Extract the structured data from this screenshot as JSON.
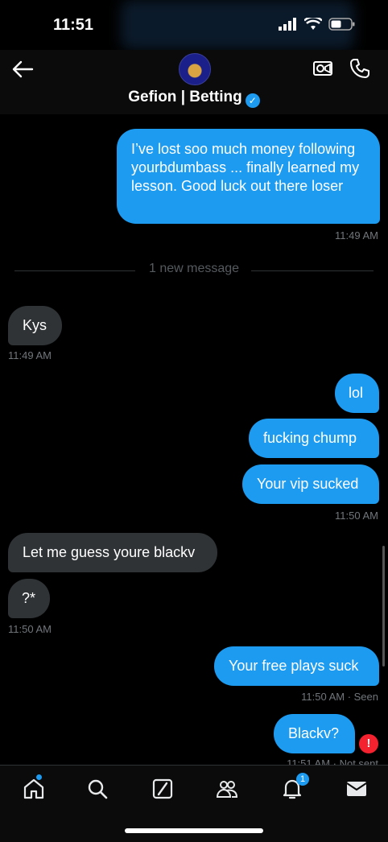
{
  "status_bar": {
    "time": "11:51"
  },
  "header": {
    "contact_name": "Gefion | Betting",
    "verified_mark": "✓"
  },
  "messages": [
    {
      "text": "I’ve lost soo much money following yourbdumbass ... finally learned my lesson.  Good luck out there loser"
    },
    {
      "text": "Kys"
    },
    {
      "text": "lol"
    },
    {
      "text": "fucking chump"
    },
    {
      "text": "Your vip sucked"
    },
    {
      "text": "Let me guess youre blackv"
    },
    {
      "text": "?*"
    },
    {
      "text": "Your free plays suck"
    },
    {
      "text": "Blackv?"
    }
  ],
  "meta": {
    "t1": "11:49 AM",
    "t2": "11:49 AM",
    "t3": "11:50 AM",
    "t4": "11:50 AM",
    "t5": "11:50 AM · Seen",
    "t6": "11:51 AM · Not sent"
  },
  "divider": "1 new message",
  "error_mark": "!",
  "nav": {
    "notification_count": "1"
  },
  "colors": {
    "accent": "#1d9bf0",
    "incoming": "#2f3336",
    "error": "#f4212e"
  },
  "icons": [
    "back-arrow-icon",
    "video-call-icon",
    "phone-icon",
    "home-icon",
    "search-icon",
    "grok-icon",
    "communities-icon",
    "bell-icon",
    "mail-icon"
  ]
}
